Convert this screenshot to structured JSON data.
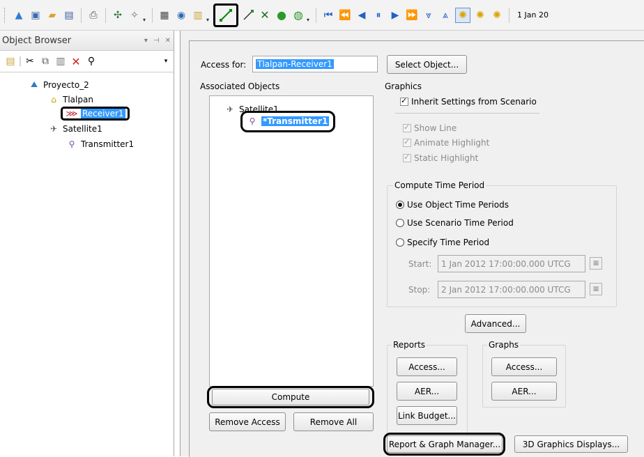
{
  "toolbar": {
    "date_label": "1 Jan 20",
    "icons": [
      "map-icon",
      "window-icon",
      "open-folder-icon",
      "save-icon",
      "print-icon",
      "scenario-tools-icon",
      "wizard-icon",
      "html-icon",
      "globe-icon",
      "report-icon",
      "access-icon",
      "link-icon",
      "tools-icon",
      "green-globe-icon",
      "zoom-icon",
      "reset-icon",
      "step-back-icon",
      "reverse-icon",
      "pause-icon",
      "play-icon",
      "step-forward-icon",
      "decrease-step-icon",
      "increase-step-icon",
      "realtime-icon",
      "clock-icon",
      "clock2-icon"
    ]
  },
  "object_browser": {
    "title": "Object Browser",
    "pin": "↓ ↑",
    "close": "×",
    "tree": [
      {
        "label": "Proyecto_2",
        "icon": "scenario-icon"
      },
      {
        "label": "Tlalpan",
        "icon": "facility-icon"
      },
      {
        "label": "Receiver1",
        "icon": "receiver-icon"
      },
      {
        "label": "Satellite1",
        "icon": "satellite-icon"
      },
      {
        "label": "Transmitter1",
        "icon": "transmitter-icon"
      }
    ]
  },
  "dialog": {
    "access_for_label": "Access for:",
    "access_for_value": "Tlalpan-Receiver1",
    "select_object": "Select Object...",
    "associated_objects": "Associated Objects",
    "assoc_tree": [
      {
        "label": "Satellite1",
        "icon": "satellite-icon"
      },
      {
        "label": "*Transmitter1",
        "icon": "transmitter-icon"
      }
    ],
    "compute": "Compute",
    "remove_access": "Remove Access",
    "remove_all": "Remove All",
    "graphics": {
      "title": "Graphics",
      "inherit": "Inherit Settings from Scenario",
      "show_line": "Show Line",
      "animate_highlight": "Animate Highlight",
      "static_highlight": "Static Highlight"
    },
    "compute_time_period": {
      "title": "Compute Time Period",
      "use_object": "Use Object Time Periods",
      "use_scenario": "Use Scenario Time Period",
      "specify": "Specify Time Period",
      "start_label": "Start:",
      "start_value": "1 Jan 2012 17:00:00.000 UTCG",
      "stop_label": "Stop:",
      "stop_value": "2 Jan 2012 17:00:00.000 UTCG"
    },
    "advanced": "Advanced...",
    "reports": {
      "title": "Reports",
      "access": "Access...",
      "aer": "AER...",
      "link_budget": "Link Budget..."
    },
    "graphs": {
      "title": "Graphs",
      "access": "Access...",
      "aer": "AER..."
    },
    "report_graph_manager": "Report & Graph Manager...",
    "graphics_3d": "3D Graphics Displays..."
  }
}
